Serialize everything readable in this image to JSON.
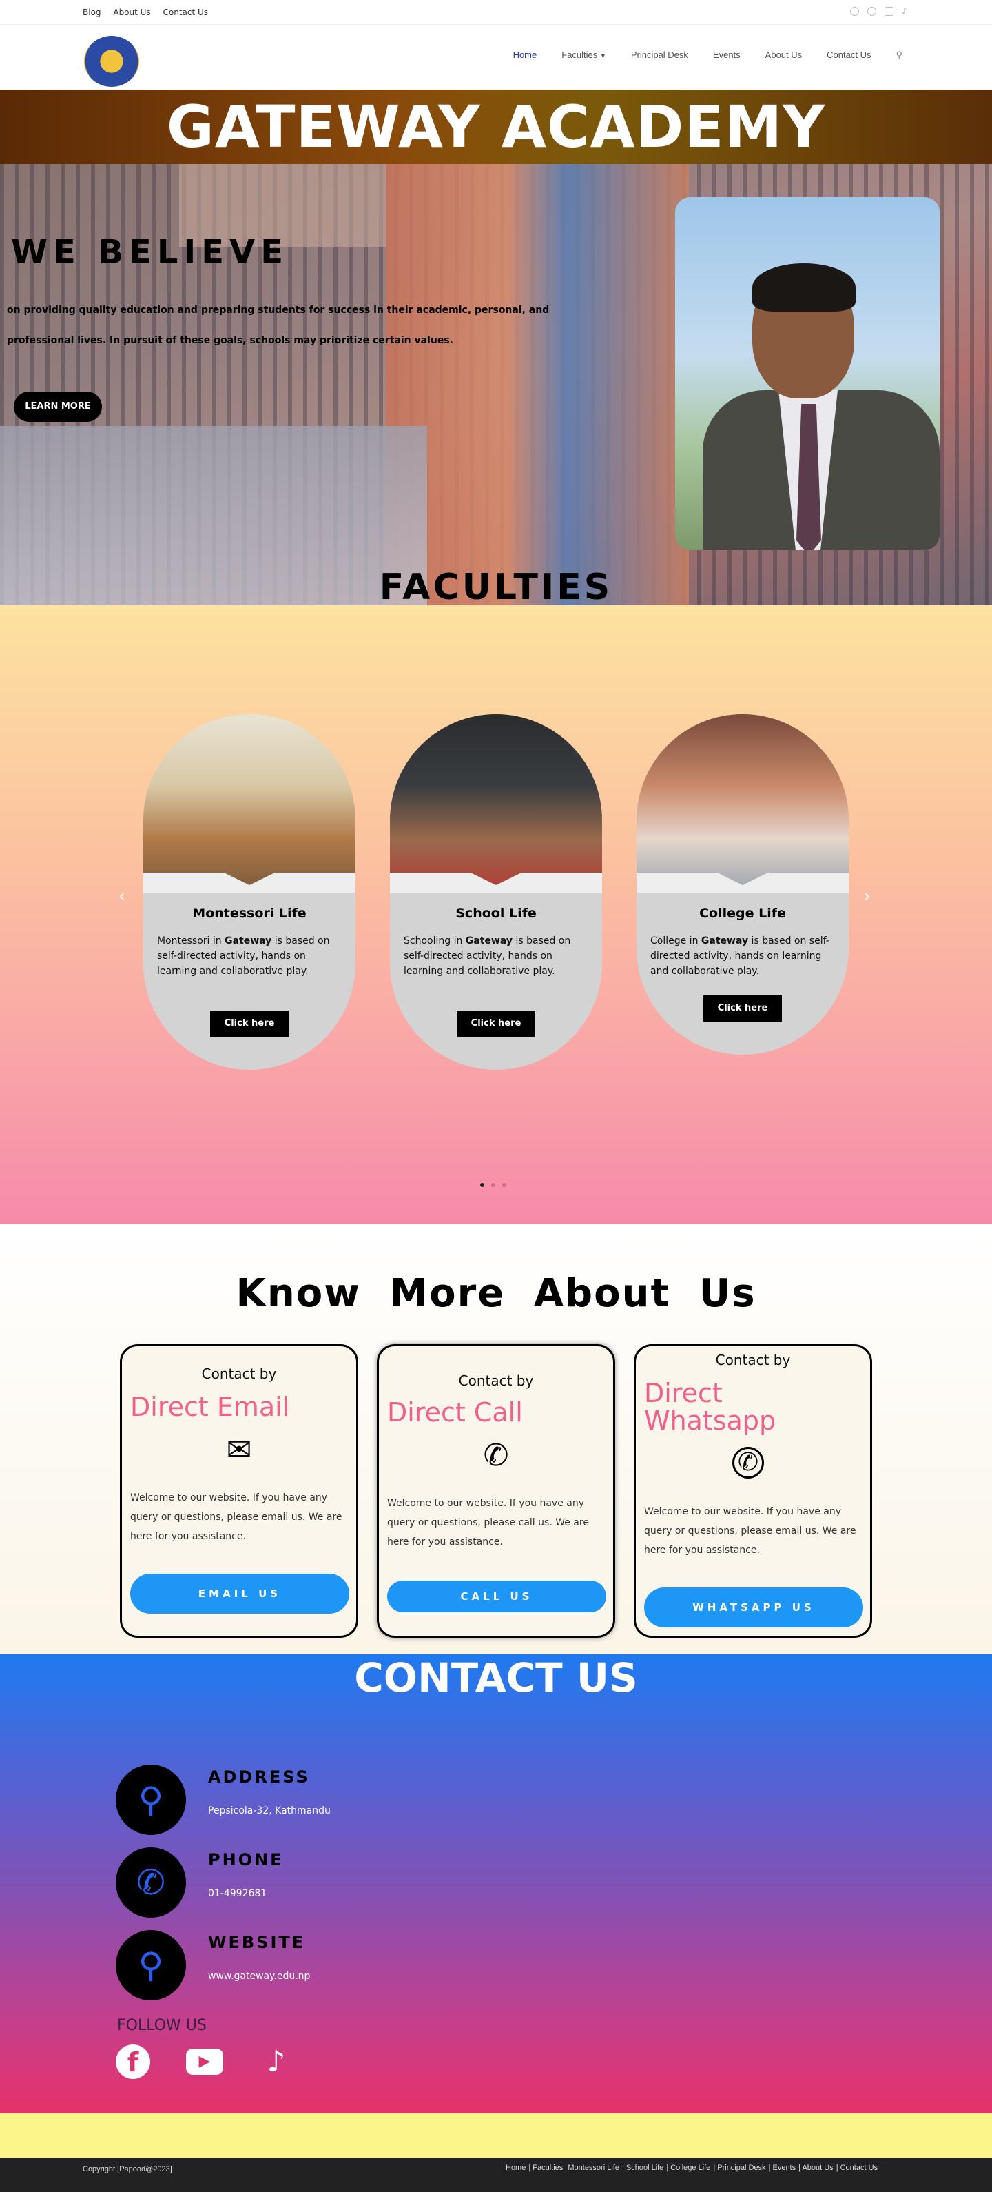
{
  "topbar": {
    "links": [
      "Blog",
      "About Us",
      "Contact Us"
    ],
    "social_icons": [
      "facebook-icon",
      "instagram-icon",
      "youtube-icon",
      "tiktok-icon"
    ]
  },
  "nav": {
    "items": [
      "Home",
      "Faculties",
      "Principal Desk",
      "Events",
      "About Us",
      "Contact Us"
    ],
    "faculties_dropdown": "chevron-down-icon",
    "search_icon": "search-icon"
  },
  "hero": {
    "title": "GATEWAY ACADEMY",
    "heading": "WE BELIEVE",
    "text": "on providing quality education and preparing students for success in their academic, personal, and professional lives. In pursuit of these goals, schools may prioritize certain values.",
    "button": "LEARN MORE"
  },
  "faculties": {
    "title": "FACULTIES",
    "cards": [
      {
        "title": "Montessori Life",
        "text_pre": "Montessori in ",
        "bold": "Gateway",
        "text_post": " is based on self-directed activity, hands on learning and collaborative play.",
        "button": "Click here"
      },
      {
        "title": "School Life",
        "text_pre": "Schooling in ",
        "bold": "Gateway",
        "text_post": " is based on self-directed activity, hands on learning and collaborative play.",
        "button": "Click here"
      },
      {
        "title": "College Life",
        "text_pre": "College in ",
        "bold": "Gateway",
        "text_post": " is based on self-directed activity, hands on learning and collaborative play.",
        "button": "Click here"
      }
    ],
    "arrow_prev": "‹",
    "arrow_next": "›"
  },
  "know": {
    "title": "Know More About Us",
    "cards": [
      {
        "by": "Contact by",
        "title": "Direct Email",
        "icon": "envelope-icon",
        "text": "Welcome to our website. If you have any query or questions, please email us. We are here for you assistance.",
        "button": "EMAIL US"
      },
      {
        "by": "Contact by",
        "title": "Direct Call",
        "icon": "phone-icon",
        "text": "Welcome to our website. If you have any query or questions, please call us. We are here for you assistance.",
        "button": "CALL US"
      },
      {
        "by": "Contact by",
        "title": "Direct Whatsapp",
        "icon": "whatsapp-icon",
        "text": "Welcome to our website. If you have any query or questions, please email us. We are here for you assistance.",
        "button": "WHATSAPP US"
      }
    ]
  },
  "contact": {
    "title": "CONTACT US",
    "address_label": "ADDRESS",
    "address": "Pepsicola-32, Kathmandu",
    "phone_label": "PHONE",
    "phone": "01-4992681",
    "website_label": "WEBSITE",
    "website": "www.gateway.edu.np",
    "follow": "FOLLOW US",
    "social": [
      "facebook-icon",
      "youtube-icon",
      "tiktok-icon"
    ]
  },
  "footer": {
    "copyright": "Copyright [Papood@2023]",
    "links": [
      "Home",
      "Faculties",
      "Montessori Life",
      "School Life",
      "College Life",
      "Principal Desk",
      "Events",
      "About Us",
      "Contact Us"
    ]
  },
  "colors": {
    "accent_pink": "#f0608a",
    "button_blue": "#1e96f5",
    "nav_active": "#2a3dbf",
    "contact_gradient_top": "#1f7af0",
    "contact_gradient_bottom": "#e8316a"
  }
}
